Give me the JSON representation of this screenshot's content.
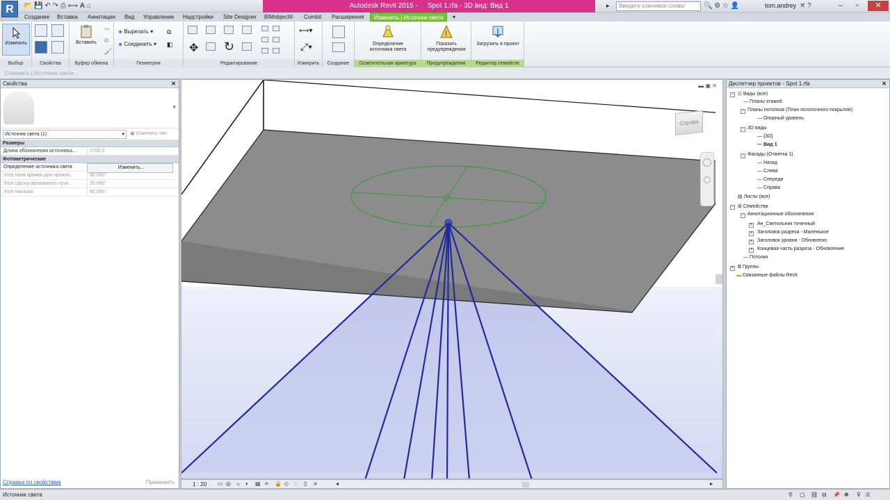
{
  "app": {
    "title": "Autodesk Revit 2015 -",
    "document": "Spot 1.rfa - 3D вид: Вид 1",
    "search_placeholder": "Введите ключевое слово/фразу",
    "user": "tom.andrey"
  },
  "tabs": [
    "Создание",
    "Вставка",
    "Аннотации",
    "Вид",
    "Управление",
    "Надстройки",
    "Site Designer",
    "BIMobject®",
    "Combit",
    "Расширения",
    "Изменить | Источник света"
  ],
  "ribbon": {
    "modify_label": "Изменить",
    "paste_label": "Вставить",
    "cut_label": "Вырезать",
    "join_label": "Соединить",
    "light_source_label": "Определение источника света",
    "warnings_label": "Показать предупреждения",
    "load_label": "Загрузить в проект",
    "panels": [
      "Выбор",
      "Свойства",
      "Буфер обмена",
      "Геометрия",
      "Редактирование",
      "Измерить",
      "Создание",
      "Осветительная арматура",
      "Предупреждения",
      "Редактор семейств"
    ]
  },
  "options_bar": "Отменить | Источник света",
  "properties": {
    "title": "Свойства",
    "type_selector": "Источник света (1)",
    "edit_type": "Изменить тип",
    "sections": {
      "dimensions": "Размеры",
      "photometric": "Фотометрические"
    },
    "rows": [
      {
        "key": "Длина обозначения источника...",
        "value": "2700.0"
      }
    ],
    "light_def": {
      "key": "Определение источника света",
      "value": "Изменить..."
    },
    "photo_rows": [
      {
        "key": "Угол поля кромки для прожек...",
        "value": "80.000°"
      },
      {
        "key": "Угол сфокусированного луча",
        "value": "35.000°"
      },
      {
        "key": "Угол наклона",
        "value": "60.000°"
      }
    ],
    "help_link": "Справка по свойствам",
    "apply": "Применить"
  },
  "viewport": {
    "scale": "1 : 20",
    "viewcube_label": "Справа"
  },
  "browser": {
    "title": "Диспетчер проектов - Spot 1.rfa",
    "items": [
      "Виды (все)",
      "Планы этажей",
      "Планы потолков (План потолочного покрытия)",
      "Опорный уровень",
      "3D виды",
      "{3D}",
      "Вид 1",
      "Фасады (Отметка 1)",
      "Назад",
      "Слева",
      "Спереди",
      "Справа",
      "Листы (все)",
      "Семейства",
      "Аннотационные обозначения",
      "Ан_Светильник точечный",
      "Заголовок разреза - Маленькое",
      "Заголовок уровня - Обновлено",
      "Концевая часть разреза - Обновление",
      "Потолки",
      "Группы",
      "Связанные файлы Revit"
    ]
  },
  "status": {
    "text": "Источник света",
    "filter_count": ":0"
  },
  "colors": {
    "title_accent": "#d8318a",
    "active_tab": "#7ac043",
    "light_cone": "#1f2a9c",
    "fixture_circle": "#3a9a3a"
  }
}
